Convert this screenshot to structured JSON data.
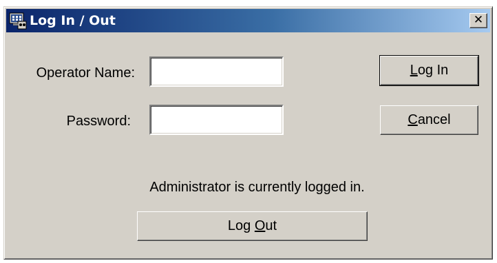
{
  "window": {
    "title": "Log In / Out",
    "close_glyph": "✕",
    "icon": "terminal-users-icon"
  },
  "form": {
    "operator_label": "Operator Name:",
    "operator_value": "",
    "password_label": "Password:",
    "password_value": ""
  },
  "buttons": {
    "login": {
      "accel": "L",
      "rest": "og In"
    },
    "cancel": {
      "accel": "C",
      "rest": "ancel"
    },
    "logout": {
      "pre": "Log ",
      "accel": "O",
      "rest": "ut"
    }
  },
  "status": {
    "text": "Administrator is currently logged in."
  },
  "colors": {
    "face": "#d4d0c8",
    "title_start": "#0a246a",
    "title_end": "#a6caf0"
  }
}
